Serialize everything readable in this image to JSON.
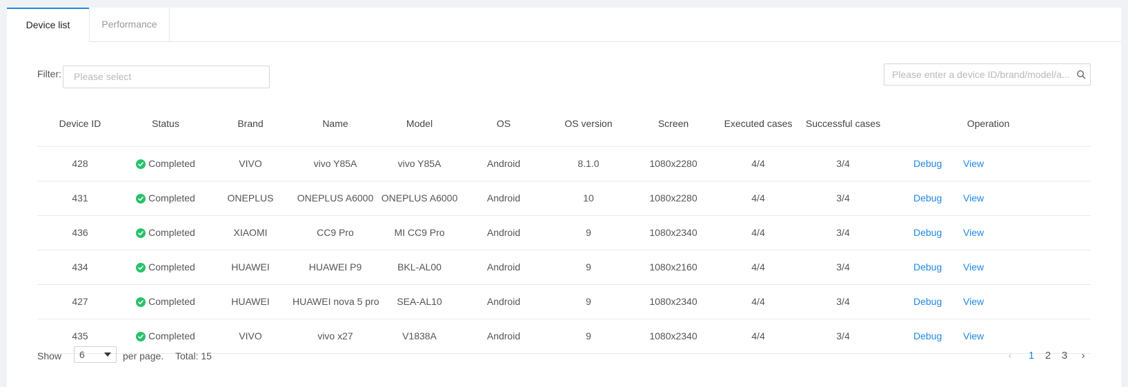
{
  "tabs": [
    {
      "label": "Device list",
      "active": true
    },
    {
      "label": "Performance",
      "active": false
    }
  ],
  "filter": {
    "label": "Filter:",
    "placeholder": "Please select"
  },
  "search": {
    "placeholder": "Please enter a device ID/brand/model/a..."
  },
  "table": {
    "headers": [
      "Device ID",
      "Status",
      "Brand",
      "Name",
      "Model",
      "OS",
      "OS version",
      "Screen",
      "Executed cases",
      "Successful cases",
      "Operation"
    ],
    "rows": [
      {
        "id": "428",
        "status": "Completed",
        "brand": "VIVO",
        "name": "vivo Y85A",
        "model": "vivo Y85A",
        "os": "Android",
        "os_version": "8.1.0",
        "screen": "1080x2280",
        "executed": "4/4",
        "successful": "3/4"
      },
      {
        "id": "431",
        "status": "Completed",
        "brand": "ONEPLUS",
        "name": "ONEPLUS A6000",
        "model": "ONEPLUS A6000",
        "os": "Android",
        "os_version": "10",
        "screen": "1080x2280",
        "executed": "4/4",
        "successful": "3/4"
      },
      {
        "id": "436",
        "status": "Completed",
        "brand": "XIAOMI",
        "name": "CC9 Pro",
        "model": "MI CC9 Pro",
        "os": "Android",
        "os_version": "9",
        "screen": "1080x2340",
        "executed": "4/4",
        "successful": "3/4"
      },
      {
        "id": "434",
        "status": "Completed",
        "brand": "HUAWEI",
        "name": "HUAWEI P9",
        "model": "BKL-AL00",
        "os": "Android",
        "os_version": "9",
        "screen": "1080x2160",
        "executed": "4/4",
        "successful": "3/4"
      },
      {
        "id": "427",
        "status": "Completed",
        "brand": "HUAWEI",
        "name": "HUAWEI nova 5 pro",
        "model": "SEA-AL10",
        "os": "Android",
        "os_version": "9",
        "screen": "1080x2340",
        "executed": "4/4",
        "successful": "3/4"
      },
      {
        "id": "435",
        "status": "Completed",
        "brand": "VIVO",
        "name": "vivo x27",
        "model": "V1838A",
        "os": "Android",
        "os_version": "9",
        "screen": "1080x2340",
        "executed": "4/4",
        "successful": "3/4"
      }
    ],
    "operations": {
      "debug": "Debug",
      "view": "View"
    }
  },
  "footer": {
    "show_label": "Show",
    "page_size": "6",
    "per_page_label": "per page.",
    "total_label": "Total: 15",
    "pages": [
      "1",
      "2",
      "3"
    ],
    "current_page": "1",
    "prev_icon": "‹",
    "next_icon": "›"
  },
  "colors": {
    "accent": "#1e88e5",
    "success": "#27c26c"
  }
}
